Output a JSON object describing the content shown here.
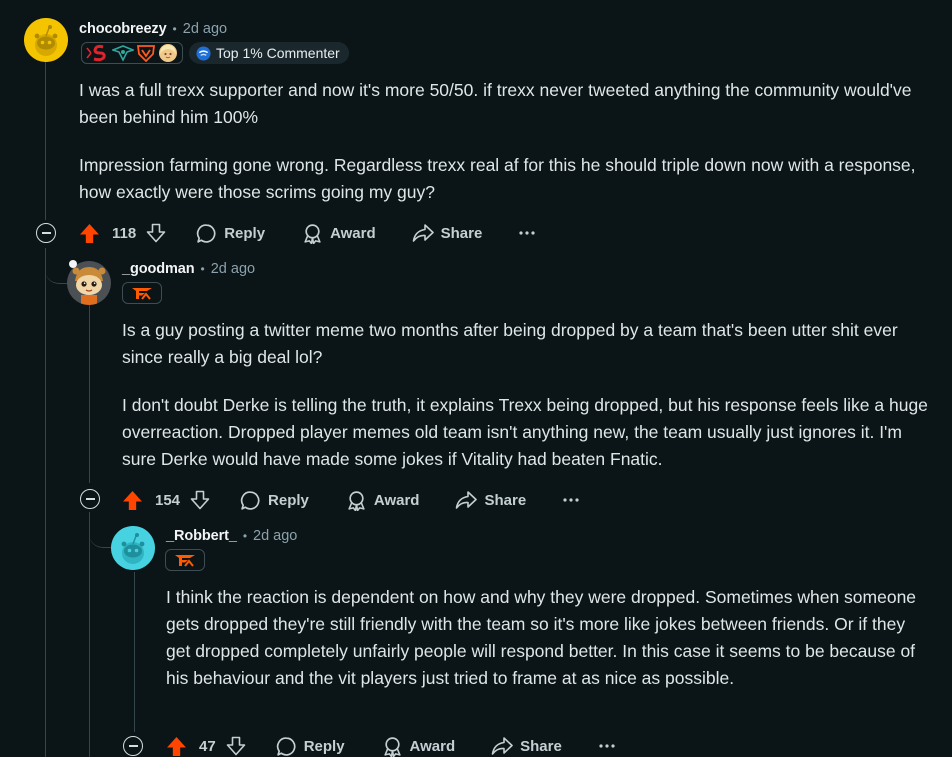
{
  "colors": {
    "background": "#0b1416",
    "upvote": "#ff4500",
    "text": "#dfe6e8",
    "muted": "#8ba2ad"
  },
  "comments": [
    {
      "username": "chocobreezy",
      "time": "2d ago",
      "badge": "Top 1% Commenter",
      "flair_icons": [
        "red-s-flair-icon",
        "teal-crest-flair-icon",
        "orange-shield-flair-icon",
        "blonde-avatar-flair-icon"
      ],
      "paragraphs": [
        "I was a full trexx supporter and now it's more 50/50. if trexx never tweeted anything the community would've been behind him 100%",
        "Impression farming gone wrong. Regardless trexx real af for this he should triple down now with a response, how exactly were those scrims going my guy?"
      ],
      "votes": "118"
    },
    {
      "username": "_goodman",
      "time": "2d ago",
      "flair_icons": [
        "fnatic-flair-icon"
      ],
      "paragraphs": [
        "Is a guy posting a twitter meme two months after being dropped by a team that's been utter shit ever since really a big deal lol?",
        "I don't doubt Derke is telling the truth, it explains Trexx being dropped, but his response feels like a huge overreaction. Dropped player memes old team isn't anything new, the team usually just ignores it. I'm sure Derke would have made some jokes if Vitality had beaten Fnatic."
      ],
      "votes": "154"
    },
    {
      "username": "_Robbert_",
      "time": "2d ago",
      "flair_icons": [
        "fnatic-flair-icon"
      ],
      "paragraphs": [
        "I think the reaction is dependent on how and why they were dropped. Sometimes when someone gets dropped they're still friendly with the team so it's more like jokes between friends. Or if they get dropped completely unfairly people will respond better. In this case it seems to be because of his behaviour and the vit players just tried to frame at as nice as possible."
      ],
      "votes": "47"
    }
  ],
  "actions": {
    "reply": "Reply",
    "award": "Award",
    "share": "Share"
  },
  "separator": "•"
}
